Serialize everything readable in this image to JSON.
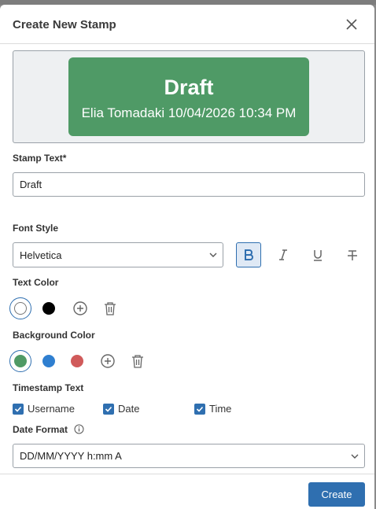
{
  "dialog": {
    "title": "Create New Stamp"
  },
  "preview": {
    "stamp_text": "Draft",
    "stamp_subtext": "Elia Tomadaki 10/04/2026 10:34 PM",
    "background_color": "#4f9a66",
    "text_color": "#ffffff"
  },
  "stamp_text": {
    "label": "Stamp Text*",
    "value": "Draft"
  },
  "font_style": {
    "label": "Font Style",
    "selected": "Helvetica",
    "buttons": [
      "bold",
      "italic",
      "underline",
      "strikethrough"
    ],
    "active": "bold"
  },
  "text_color": {
    "label": "Text Color",
    "swatches": [
      "#ffffff",
      "#000000"
    ],
    "selected": "#ffffff"
  },
  "background_color": {
    "label": "Background Color",
    "swatches": [
      "#4f9a66",
      "#2f7fd0",
      "#d05a5a"
    ],
    "selected": "#4f9a66"
  },
  "timestamp": {
    "label": "Timestamp Text",
    "options": [
      {
        "label": "Username",
        "checked": true
      },
      {
        "label": "Date",
        "checked": true
      },
      {
        "label": "Time",
        "checked": true
      }
    ]
  },
  "date_format": {
    "label": "Date Format",
    "selected": "DD/MM/YYYY h:mm A"
  },
  "footer": {
    "create_label": "Create"
  },
  "colors": {
    "accent": "#2f6fb0"
  }
}
